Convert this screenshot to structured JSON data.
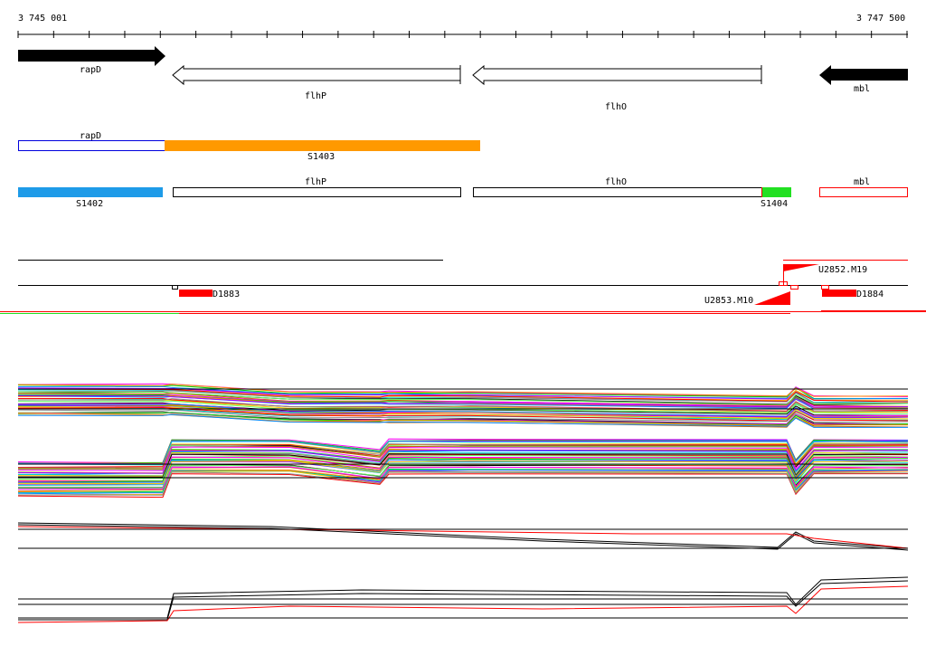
{
  "axis": {
    "start_label": "3 745 001",
    "end_label": "3 747 500",
    "tick_count": 25
  },
  "genes": [
    {
      "name": "rapD",
      "strand": "+"
    },
    {
      "name": "flhP",
      "strand": "-"
    },
    {
      "name": "flhO",
      "strand": "-"
    },
    {
      "name": "mbl",
      "strand": "-"
    }
  ],
  "segments_row1": [
    {
      "label": "rapD"
    },
    {
      "label": "S1403",
      "color": "#ff9900"
    }
  ],
  "segments_row2": [
    {
      "label": "S1402",
      "color": "#1e9be8"
    },
    {
      "label": "flhP"
    },
    {
      "label": "flhO"
    },
    {
      "label": "S1404",
      "color": "#22e022"
    },
    {
      "label": "mbl"
    }
  ],
  "features": [
    {
      "label": "D1883",
      "color": "#ff0000"
    },
    {
      "label": "U2852.M19",
      "color": "#ff0000"
    },
    {
      "label": "U2853.M10",
      "color": "#ff0000"
    },
    {
      "label": "D1884",
      "color": "#ff0000"
    }
  ]
}
